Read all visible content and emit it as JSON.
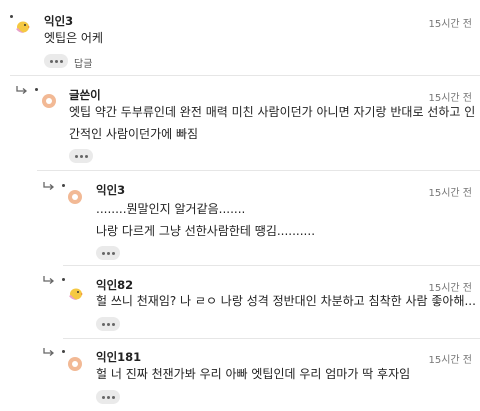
{
  "comments": [
    {
      "name": "익인3",
      "time": "15시간 전",
      "lines": [
        "엣팁은 어케"
      ],
      "reply_label": "답글",
      "avatar": "chick-icon"
    },
    {
      "name": "글쓴이",
      "time": "15시간 전",
      "lines": [
        "엣팁 약간 두부류인데 완전 매력 미친 사람이던가 아니면 자기랑 반대로 선하고 인",
        "간적인 사람이던가에 빠짐"
      ],
      "avatar": "peach-circle-icon"
    },
    {
      "name": "익인3",
      "time": "15시간 전",
      "lines": [
        "........뭔말인지 알거같음.......",
        "나랑 다르게 그냥 선한사람한테 땡김.........."
      ],
      "avatar": "peach-circle-icon"
    },
    {
      "name": "익인82",
      "time": "15시간 전",
      "lines": [
        "헐 쓰니 천재임? 나 ㄹㅇ 나랑 성격 정반대인 차분하고 침착한 사람 좋아해..."
      ],
      "avatar": "chick-icon"
    },
    {
      "name": "익인181",
      "time": "15시간 전",
      "lines": [
        "헐 너 진짜 천잰가봐 우리 아빠 엣팁인데 우리 엄마가 딱 후자임"
      ],
      "avatar": "peach-circle-icon"
    }
  ],
  "colors": {
    "divider": "#e6e6e6",
    "chick_body": "#f5c842",
    "chick_accent": "#e8a0c8",
    "peach_outer": "#f2b995",
    "peach_inner": "#ffffff"
  }
}
